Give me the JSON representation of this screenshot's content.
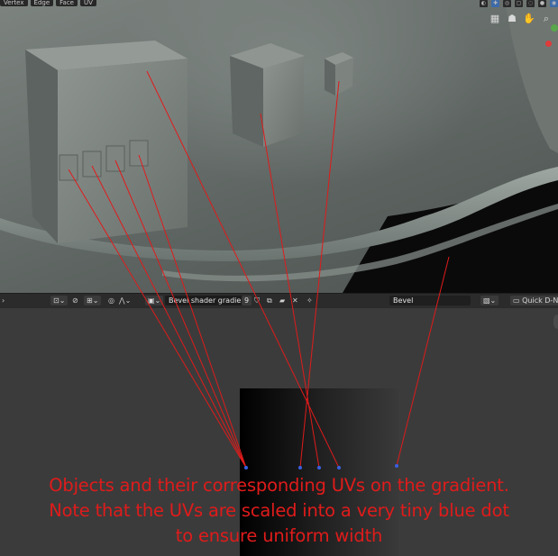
{
  "viewport": {
    "mode_buttons": [
      "Vertex",
      "Edge",
      "Face",
      "UV"
    ],
    "nav_icons": [
      "grid-icon",
      "camera-icon",
      "hand-icon",
      "zoom-icon"
    ]
  },
  "editor_header": {
    "image_name": "Bevel shader gradie..",
    "user_count": "9",
    "uv_map_field": "Bevel",
    "quick_button": "Quick D-N"
  },
  "caption": {
    "line1": "Objects and their corresponding UVs on the gradient.",
    "line2": "Note that the UVs are scaled into a very tiny blue dot",
    "line3": "to ensure uniform width"
  },
  "colors": {
    "annotation_red": "#e01b1b",
    "uv_dot_blue": "#3a5fe0",
    "header_bg": "#2b2b2b",
    "editor_bg": "#3b3b3b"
  }
}
